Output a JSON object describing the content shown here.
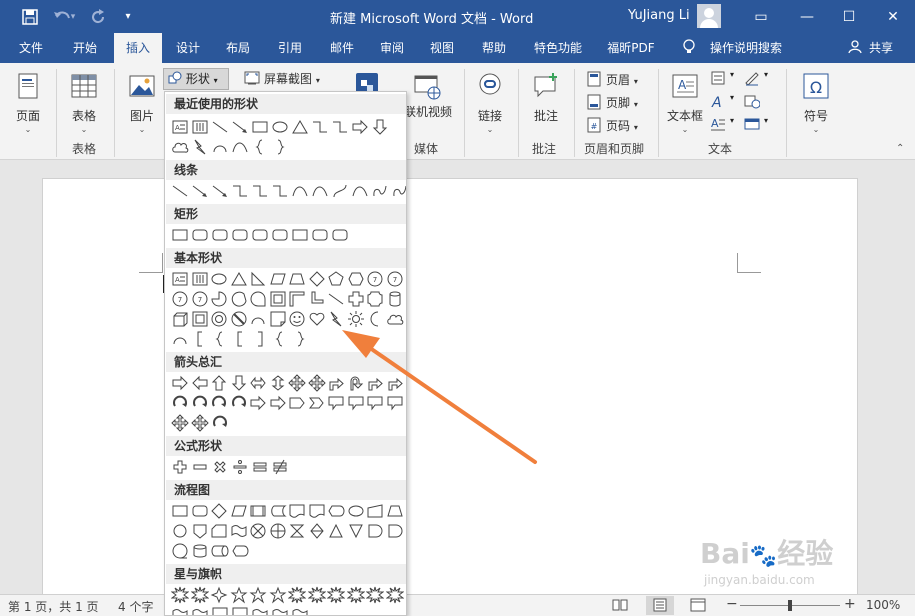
{
  "titlebar": {
    "doc_title": "新建 Microsoft Word 文档  -  Word",
    "user_name": "YuJiang Li",
    "minimize": "—",
    "maximize": "☐",
    "close": "✕",
    "ribbon_options": "▭",
    "save_icon": "save-icon",
    "undo_icon": "undo-icon",
    "redo_icon": "redo-icon",
    "customize": "▾"
  },
  "tabs": [
    {
      "label": "文件"
    },
    {
      "label": "开始"
    },
    {
      "label": "插入"
    },
    {
      "label": "设计"
    },
    {
      "label": "布局"
    },
    {
      "label": "引用"
    },
    {
      "label": "邮件"
    },
    {
      "label": "审阅"
    },
    {
      "label": "视图"
    },
    {
      "label": "帮助"
    },
    {
      "label": "特色功能"
    },
    {
      "label": "福昕PDF"
    },
    {
      "label": "操作说明搜索"
    },
    {
      "label": "共享"
    }
  ],
  "ribbon": {
    "pages": "页面",
    "table": "表格",
    "table_group": "表格",
    "pictures": "图片",
    "shapes": "形状",
    "screenshot": "屏幕截图",
    "online_video": "联机视频",
    "media_group": "媒体",
    "link": "链接",
    "comment": "批注",
    "comment_group": "批注",
    "header": "页眉",
    "footer": "页脚",
    "page_number": "页码",
    "header_footer_group": "页眉和页脚",
    "textbox": "文本框",
    "text_group": "文本",
    "symbol": "符号"
  },
  "shapes_menu": {
    "sections": [
      {
        "title": "最近使用的形状"
      },
      {
        "title": "线条"
      },
      {
        "title": "矩形"
      },
      {
        "title": "基本形状"
      },
      {
        "title": "箭头总汇"
      },
      {
        "title": "公式形状"
      },
      {
        "title": "流程图"
      },
      {
        "title": "星与旗帜"
      }
    ]
  },
  "status": {
    "page": "第 1 页，共 1 页",
    "words": "4 个字",
    "zoom": "100%",
    "minus": "−",
    "plus": "+"
  },
  "watermark": {
    "brand": "Bai经验",
    "url": "jingyan.baidu.com"
  },
  "colors": {
    "accent": "#2b579a",
    "arrow": "#f07f3c"
  }
}
